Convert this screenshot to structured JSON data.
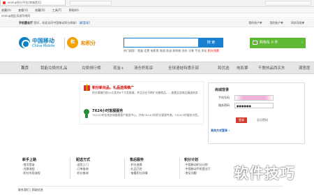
{
  "browser": {
    "tab_title": "ecolup积分平台(商城首页)",
    "menu": [
      "收藏(A)",
      "查看(V)",
      "收藏(O)",
      "工具(T)",
      "帮助(H)"
    ],
    "url": "ecolup就此扣减华南网"
  },
  "topbar": {
    "label": "手机营业厅",
    "greeting": "您好，欢迎访问中国移动积分商城！",
    "login_link": "请[登录]",
    "right_links": [
      "我的账户▼",
      "我的账户▼",
      "网站导航▼"
    ]
  },
  "header": {
    "logo_cn": "中国移动",
    "logo_en": "China Mobile",
    "brand_badge": "和",
    "brand_name": "和积分",
    "search_placeholder": "",
    "search_button": "搜 索",
    "hot_label": "热门搜索：",
    "hot_terms": "食盒 话费 电影票 旅游 加油 和购物 洗衣 牙膏 手机 净化 ",
    "hot_highlight": "积分兑换",
    "cart_label": "购物车 0 件",
    "cart_arrow": "›"
  },
  "nav": {
    "items": [
      "首页",
      "我能兑换的礼品",
      "兑换排行榜",
      "现金+",
      "清仓积和享",
      "全球速蛙特惠乐部",
      "和优选",
      "电影票",
      "千教热品西买东",
      "满意度"
    ]
  },
  "main": {
    "promo1_title": "积分新兑品，礼品选择推广",
    "promo1_desc": "积分商城目前10大类共6个大类商城，并且还在不断扩充着商品……查看全部商品精选热卖",
    "promo2_title": "7X24小时客服服务",
    "promo2_desc": "7X24小时在线咨询整理客户服务中心，并有7X24小时积分客服专席，7X24小时服务为您。"
  },
  "login": {
    "title": "商城登录",
    "phone_label": "手机号码",
    "password_label": "服务密码",
    "password_value": "●●●●●●",
    "login_button": "登录",
    "forgot": "忘记密码",
    "other_login": "其他方式登录 ›"
  },
  "footer": {
    "columns": [
      {
        "title": "新手上路",
        "items": [
          "首页登录",
          "兑换流程",
          "积分兑现流程"
        ]
      },
      {
        "title": "配送方式",
        "items": [
          "送货上门",
          "订单查询",
          "积分查询"
        ]
      },
      {
        "title": "售后服务",
        "items": [
          "积分退换",
          "礼品已验",
          "查看积分详情"
        ]
      },
      {
        "title": "积分计划",
        "items": [
          "中国移动积分计划",
          "中国移动手机营业厅",
          "常见问题"
        ]
      }
    ],
    "bottom": "联系我们 | 帮助信息"
  },
  "watermark": "软件技巧"
}
